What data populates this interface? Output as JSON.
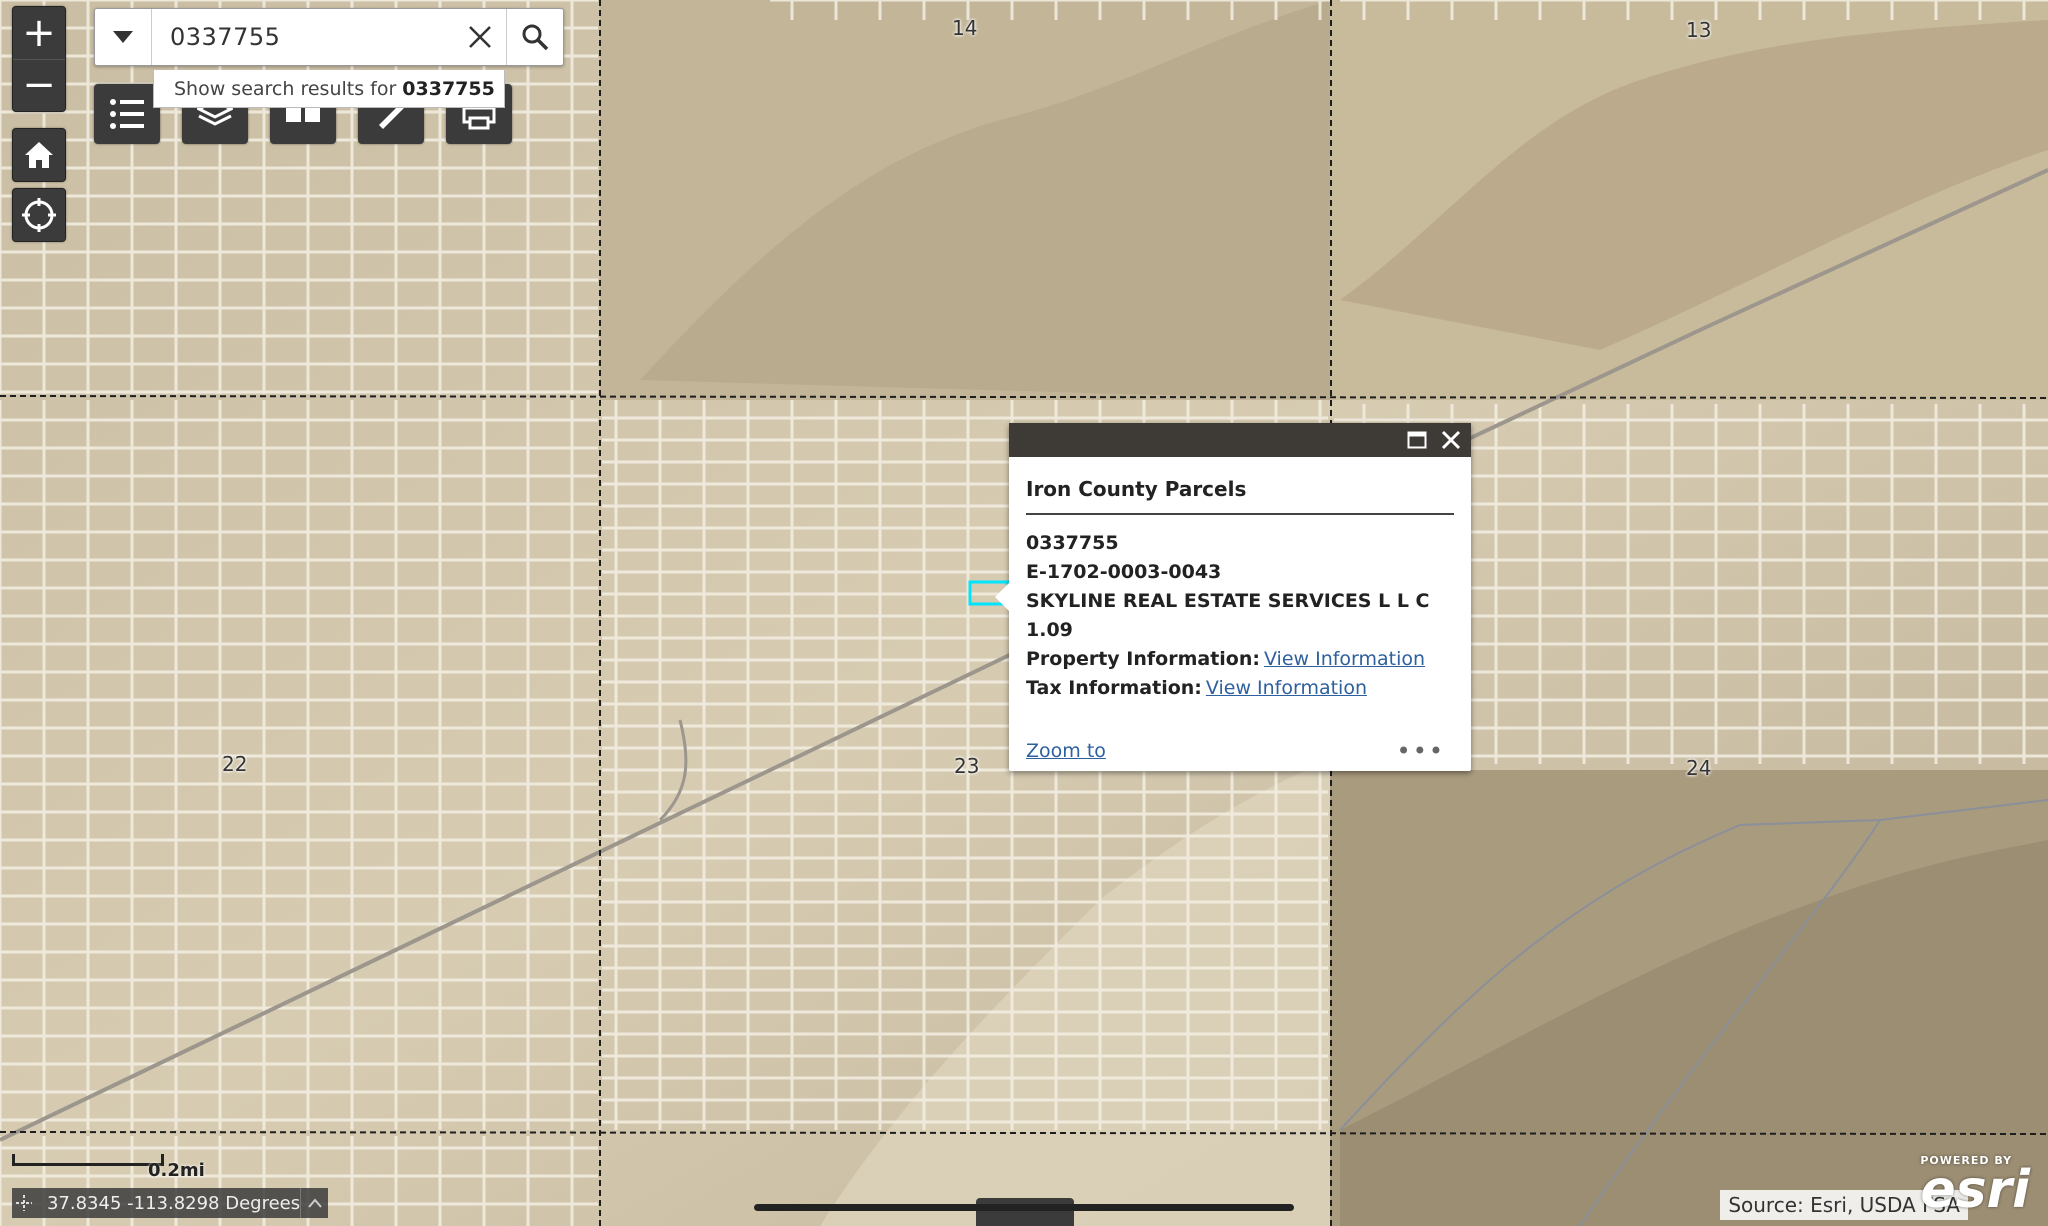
{
  "search": {
    "value": "0337755",
    "suggestion_prefix": "Show search results for",
    "suggestion_term": "0337755"
  },
  "controls": {
    "zoom_in": "+",
    "zoom_out": "−"
  },
  "toolbar": {
    "icons": [
      "list-icon",
      "layers-icon",
      "basemap-icon",
      "measure-icon",
      "print-icon"
    ]
  },
  "map": {
    "section_labels": [
      "14",
      "13",
      "22",
      "23",
      "24"
    ],
    "basemap": "imagery"
  },
  "popup": {
    "title": "Iron County Parcels",
    "parcel_id": "0337755",
    "account": "E-1702-0003-0043",
    "owner": "SKYLINE REAL ESTATE SERVICES L L C",
    "acres": "1.09",
    "property_label": "Property Information:",
    "property_link": "View Information",
    "tax_label": "Tax Information:",
    "tax_link": "View Information",
    "zoom_to": "Zoom to",
    "more": "•••"
  },
  "scale": {
    "label": "0.2mi"
  },
  "coordinates": {
    "text": "37.8345 -113.8298 Degrees"
  },
  "attribution": {
    "source": "Source: Esri, USDA FSA",
    "powered_by": "POWERED BY",
    "logo": "esri"
  },
  "colors": {
    "control_bg": "#3b3b3b",
    "popup_header": "#3e3a36",
    "link": "#2e5f9e",
    "highlight": "#00e5ff"
  }
}
